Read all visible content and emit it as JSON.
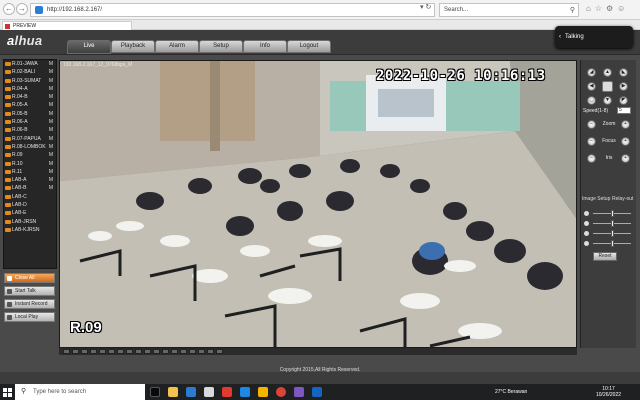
{
  "browser": {
    "url": "http://192.168.2.167/",
    "search_placeholder": "Search...",
    "tab_title": "PREVIEW"
  },
  "app": {
    "logo_a": "a",
    "logo_hua": "lhua",
    "tabs": [
      "Live",
      "Playback",
      "Alarm",
      "Setup",
      "Info",
      "Logout"
    ],
    "active_tab": "Live",
    "talk_label": "Talking"
  },
  "channels": [
    {
      "label": "R.01-JAWA",
      "flag": "M"
    },
    {
      "label": "R.02-BALI",
      "flag": "M"
    },
    {
      "label": "R.03-SUMAT",
      "flag": "M"
    },
    {
      "label": "R.04-A",
      "flag": "M"
    },
    {
      "label": "R.04-B",
      "flag": "M"
    },
    {
      "label": "R.05-A",
      "flag": "M"
    },
    {
      "label": "R.05-B",
      "flag": "M"
    },
    {
      "label": "R.06-A",
      "flag": "M"
    },
    {
      "label": "R.06-B",
      "flag": "M"
    },
    {
      "label": "R.07-PAPUA",
      "flag": "M"
    },
    {
      "label": "R.08-LOMBOK",
      "flag": "M"
    },
    {
      "label": "R.09",
      "flag": "M"
    },
    {
      "label": "R.10",
      "flag": "M"
    },
    {
      "label": "R.11",
      "flag": "M"
    },
    {
      "label": "LAB-A",
      "flag": "M"
    },
    {
      "label": "LAB-B",
      "flag": "M"
    },
    {
      "label": "LAB-C",
      "flag": ""
    },
    {
      "label": "LAB-D",
      "flag": ""
    },
    {
      "label": "LAB-E",
      "flag": ""
    },
    {
      "label": "LAB-JRSN",
      "flag": ""
    },
    {
      "label": "LAB-KJRSN",
      "flag": ""
    }
  ],
  "actions": {
    "close_all": "Close All",
    "start_talk": "Start Talk",
    "instant_record": "Instant Record",
    "local_play": "Local Play"
  },
  "video": {
    "info": "192.168.2.167_12_9768bps_M",
    "timestamp": "2022-10-26 10:16:13",
    "room_label": "R.09"
  },
  "ptz": {
    "speed_label": "Speed(1-8)",
    "speed_value": "5",
    "zoom_label": "Zoom",
    "focus_label": "Focus",
    "iris_label": "Iris",
    "image_setup": "Image Setup",
    "relay_out": "Relay-out",
    "reset_label": "Reset",
    "sliders": [
      {
        "name": "brightness",
        "value": 0.5
      },
      {
        "name": "contrast",
        "value": 0.5
      },
      {
        "name": "saturation",
        "value": 0.5
      },
      {
        "name": "hue",
        "value": 0.5
      }
    ]
  },
  "footer": {
    "copyright": "Copyright 2015,All Rights Reserved."
  },
  "taskbar": {
    "search_placeholder": "Type here to search",
    "weather": "27°C  Berawan",
    "time": "10:17",
    "date": "10/26/2022"
  },
  "colors": {
    "accent_orange": "#e28a1a",
    "panel_dark": "#262626",
    "frame_gray": "#4a4a4a"
  }
}
